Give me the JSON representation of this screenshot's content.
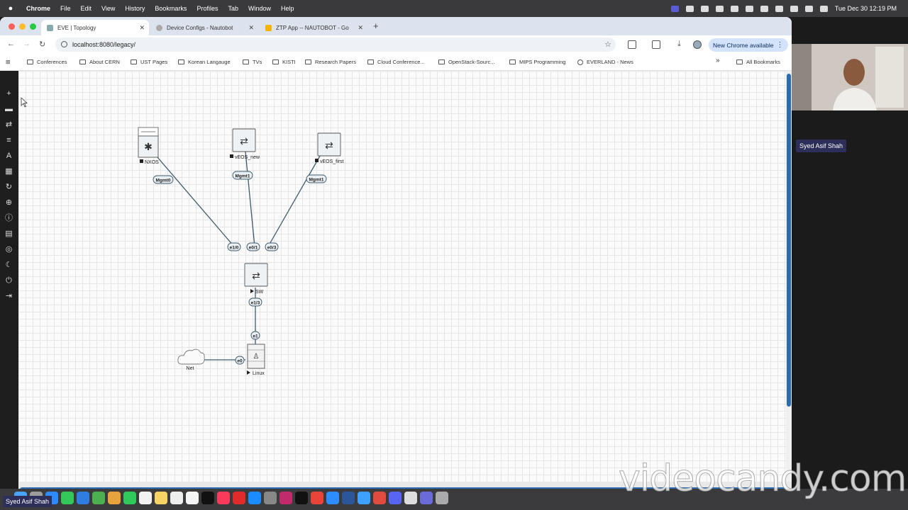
{
  "menubar": {
    "app": "Chrome",
    "items": [
      "File",
      "Edit",
      "View",
      "History",
      "Bookmarks",
      "Profiles",
      "Tab",
      "Window",
      "Help"
    ],
    "datetime": "Tue Dec 30  12:19 PM"
  },
  "tabs": [
    {
      "label": "EVE | Topology",
      "active": true
    },
    {
      "label": "Device Configs - Nautobot",
      "active": false
    },
    {
      "label": "ZTP App -- NAUTOBOT - Go",
      "active": false
    }
  ],
  "toolbar": {
    "url": "localhost:8080/legacy/",
    "new_chrome": "New Chrome available"
  },
  "bookmarks": {
    "items": [
      "Conferences",
      "About CERN",
      "UST Pages",
      "Korean Langauge",
      "TVs",
      "KISTI",
      "Research Papers",
      "Cloud Conference...",
      "OpenStack-Sourc...",
      "MIPS Programming",
      "EVERLAND - News"
    ],
    "all": "All Bookmarks",
    "overflow": "»"
  },
  "topology": {
    "nodes": {
      "nxos": "NXOS",
      "veos_new": "vEOS_new",
      "veos_first": "vEOS_first",
      "sw": "SW",
      "linux": "Linux",
      "net": "Net"
    },
    "ports": {
      "nxos_mgmt": "Mgmt0",
      "veos_new_mgmt": "Mgmt1",
      "veos_first_mgmt": "Mgmt1",
      "sw_e10": "e1/0",
      "sw_e01": "e0/1",
      "sw_e03": "e0/3",
      "sw_e13": "e1/3",
      "linux_e1": "e1",
      "linux_e0": "e0"
    }
  },
  "participant": {
    "name": "Syed Asif Shah"
  },
  "watermark": "videocandy.com",
  "colors": {
    "menubar": "#3a3a3c",
    "sidebar": "#1e1e1e",
    "scroll_accent": "#2b6cb0",
    "link_line": "#3d5a6b"
  }
}
